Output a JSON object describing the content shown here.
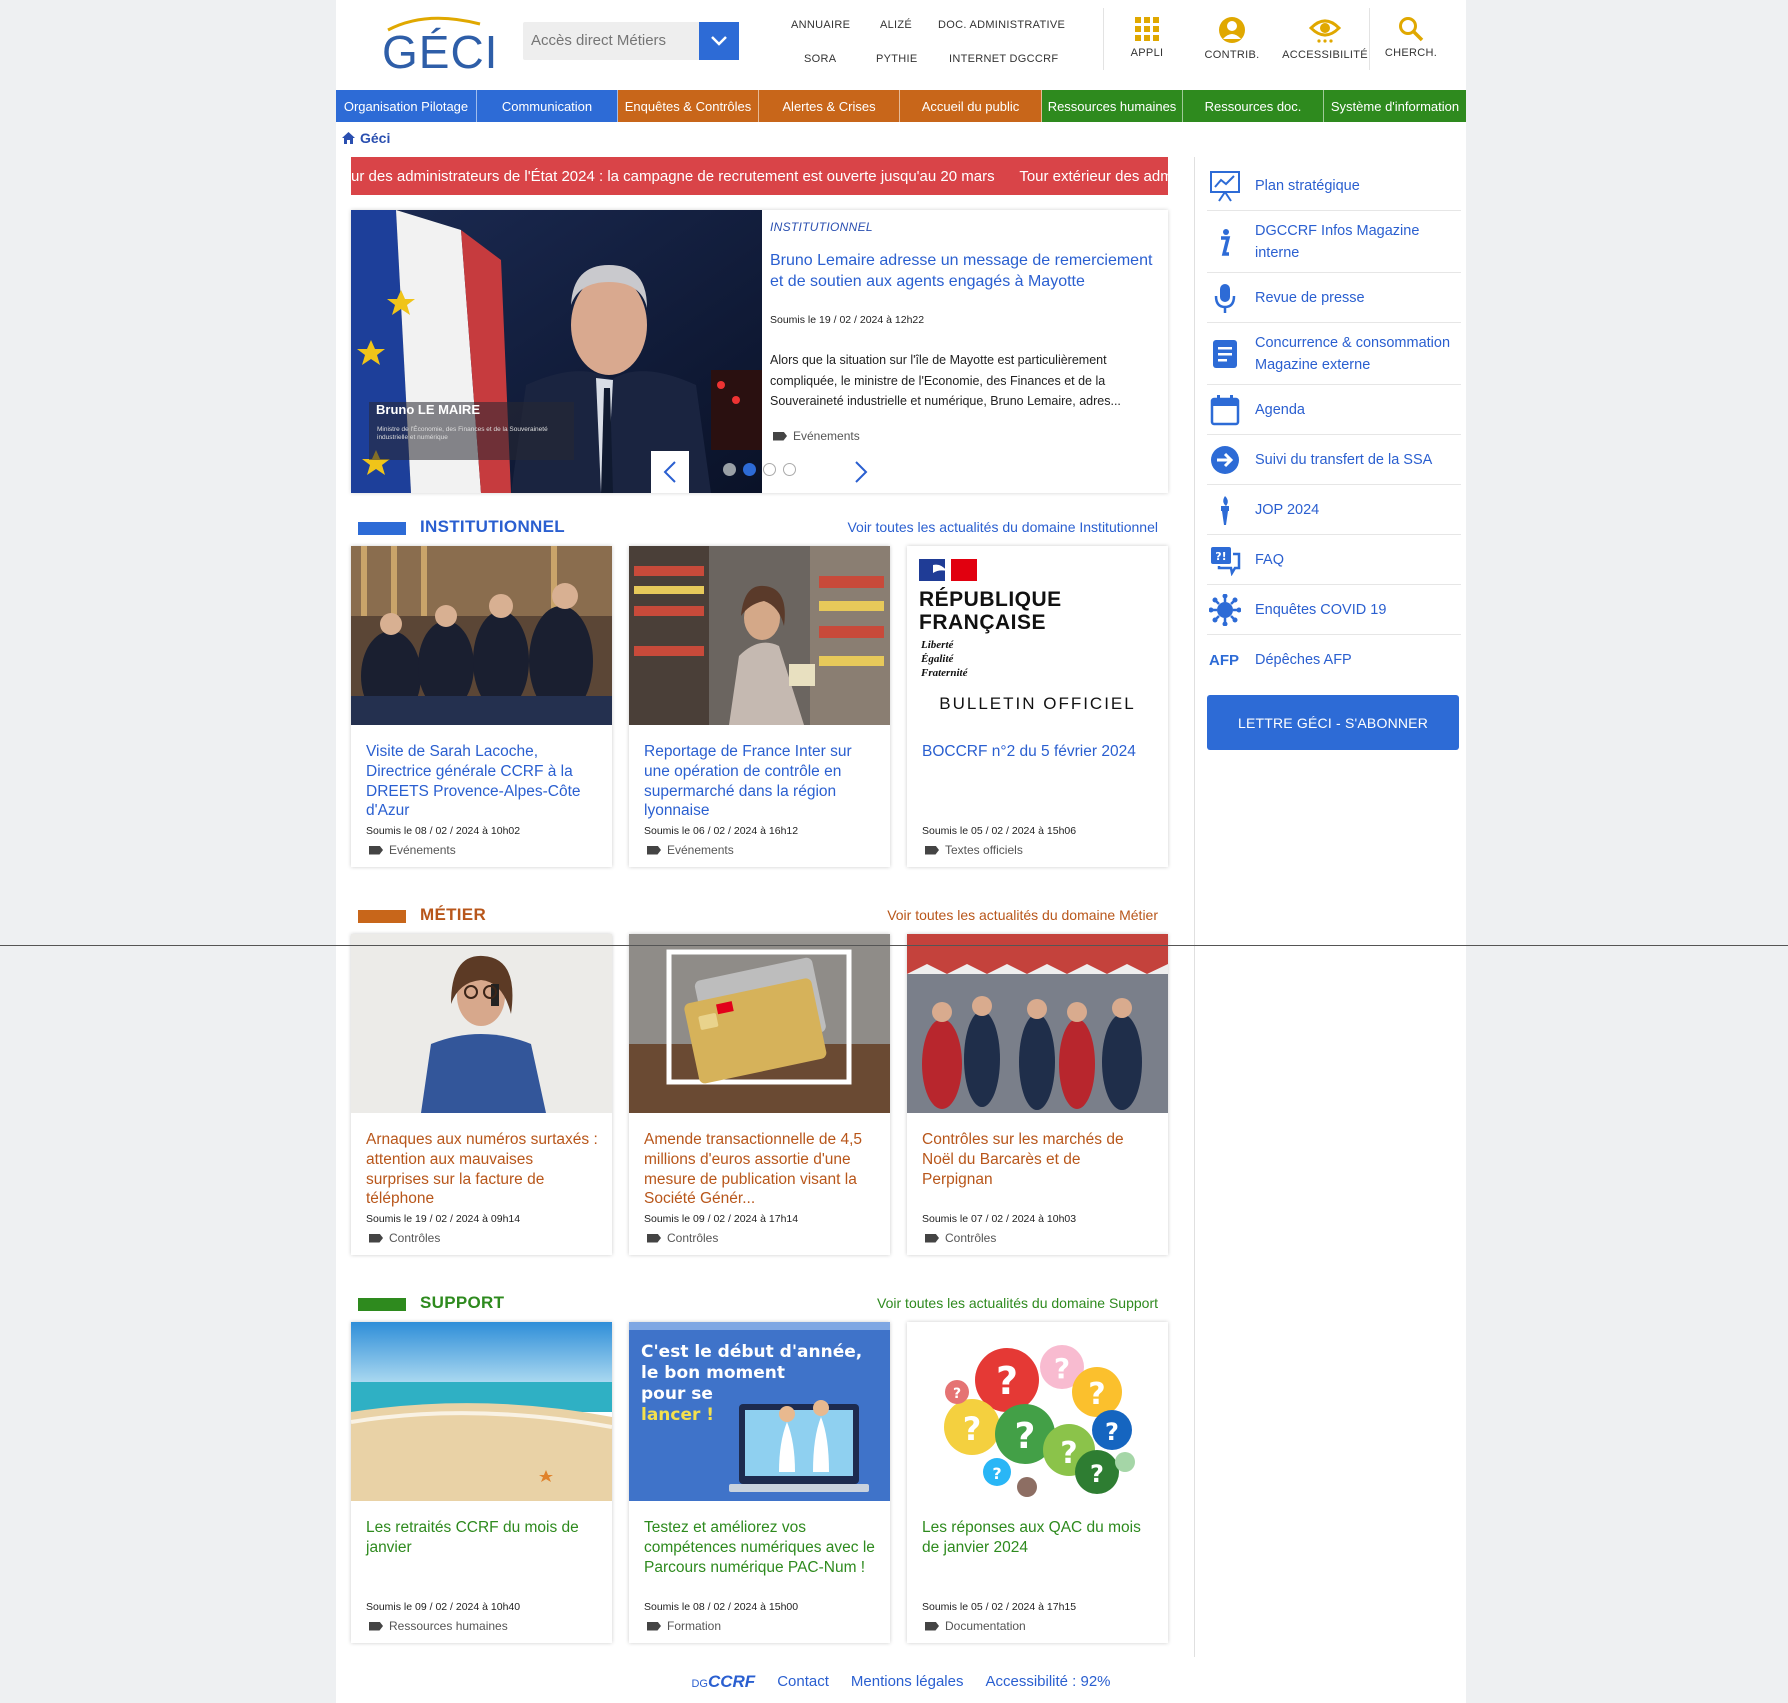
{
  "logo": {
    "text": "GÉCI"
  },
  "search": {
    "placeholder": "Accès direct Métiers"
  },
  "quick_links": [
    "ANNUAIRE",
    "ALIZÉ",
    "DOC. ADMINISTRATIVE",
    "SORA",
    "PYTHIE",
    "INTERNET DGCCRF"
  ],
  "toolbar": {
    "appli": "APPLI",
    "contrib": "CONTRIB.",
    "accessibility": "ACCESSIBILITÉ",
    "search": "CHERCH."
  },
  "nav": [
    {
      "label": "Organisation Pilotage",
      "color": "#2d6bd6"
    },
    {
      "label": "Communication",
      "color": "#2d6bd6"
    },
    {
      "label": "Enquêtes & Contrôles",
      "color": "#c8661a"
    },
    {
      "label": "Alertes & Crises",
      "color": "#c8661a"
    },
    {
      "label": "Accueil du public",
      "color": "#c8661a"
    },
    {
      "label": "Ressources humaines",
      "color": "#2e8a1e"
    },
    {
      "label": "Ressources doc.",
      "color": "#2e8a1e"
    },
    {
      "label": "Système d'information",
      "color": "#2e8a1e"
    }
  ],
  "breadcrumb": "Géci",
  "ticker": "ur des administrateurs de l'État 2024 : la campagne de recrutement est ouverte jusqu'au 20 mars      Tour extérieur des admi",
  "hero": {
    "image_caption_name": "Bruno LE MAIRE",
    "image_caption_role": "Ministre de l'Économie, des Finances et de la Souveraineté industrielle et numérique",
    "category": "INSTITUTIONNEL",
    "title": "Bruno Lemaire adresse un message de remerciement et de soutien aux agents engagés à Mayotte",
    "date": "Soumis le 19 / 02 / 2024 à 12h22",
    "summary": "Alors que la situation sur l'île de Mayotte est particulièrement compliquée, le ministre de l'Economie, des Finances et de la Souveraineté industrielle et numérique, Bruno Lemaire, adres...",
    "tag": "Evénements",
    "slide_index": 2,
    "slide_count": 4
  },
  "sections": [
    {
      "title": "INSTITUTIONNEL",
      "color": "#2d6bd6",
      "link": "Voir toutes les actualités du domaine Institutionnel",
      "cards": [
        {
          "title": "Visite de Sarah Lacoche, Directrice générale CCRF à la DREETS Provence-Alpes-Côte d'Azur",
          "date": "Soumis le 08 / 02 / 2024 à 10h02",
          "tag": "Evénements"
        },
        {
          "title": "Reportage de France Inter sur une opération de contrôle en supermarché dans la région lyonnaise",
          "date": "Soumis le 06 / 02 / 2024 à 16h12",
          "tag": "Evénements"
        },
        {
          "title": "BOCCRF n°2 du 5 février 2024",
          "date": "Soumis le 05 / 02 / 2024 à 15h06",
          "tag": "Textes officiels"
        }
      ]
    },
    {
      "title": "MÉTIER",
      "color": "#c8661a",
      "link": "Voir toutes les actualités du domaine Métier",
      "cards": [
        {
          "title": "Arnaques aux numéros surtaxés : attention aux mauvaises surprises sur la facture de téléphone",
          "date": "Soumis le 19 / 02 / 2024 à 09h14",
          "tag": "Contrôles"
        },
        {
          "title": "Amende transactionnelle de 4,5 millions d'euros assortie d'une mesure de publication visant la Société Génér...",
          "date": "Soumis le 09 / 02 / 2024 à 17h14",
          "tag": "Contrôles"
        },
        {
          "title": "Contrôles sur les marchés de Noël du Barcarès et de Perpignan",
          "date": "Soumis le 07 / 02 / 2024 à 10h03",
          "tag": "Contrôles"
        }
      ]
    },
    {
      "title": "SUPPORT",
      "color": "#2e8a1e",
      "link": "Voir toutes les actualités du domaine Support",
      "cards": [
        {
          "title": "Les retraités CCRF du mois de janvier",
          "date": "Soumis le 09 / 02 / 2024 à 10h40",
          "tag": "Ressources humaines"
        },
        {
          "title": "Testez et améliorez vos compétences numériques avec le Parcours numérique PAC-Num !",
          "date": "Soumis le 08 / 02 / 2024 à 15h00",
          "tag": "Formation"
        },
        {
          "title": "Les réponses aux QAC du mois de janvier 2024",
          "date": "Soumis le 05 / 02 / 2024 à 17h15",
          "tag": "Documentation"
        }
      ]
    }
  ],
  "image_texts": {
    "republique_1": "RÉPUBLIQUE",
    "republique_2": "FRANÇAISE",
    "devise": [
      "Liberté",
      "Égalité",
      "Fraternité"
    ],
    "bulletin": "BULLETIN OFFICIEL",
    "pacnum_1": "C'est le début d'année,",
    "pacnum_2": "le bon moment",
    "pacnum_3": "pour se",
    "pacnum_4": "lancer !"
  },
  "sidebar": [
    {
      "label": "Plan stratégique",
      "icon": "presentation-board-icon"
    },
    {
      "label": "DGCCRF Infos Magazine interne",
      "icon": "info-icon"
    },
    {
      "label": "Revue de presse",
      "icon": "microphone-icon"
    },
    {
      "label": "Concurrence & consommation Magazine externe",
      "icon": "document-icon"
    },
    {
      "label": "Agenda",
      "icon": "calendar-icon"
    },
    {
      "label": "Suivi du transfert de la SSA",
      "icon": "arrow-circle-icon"
    },
    {
      "label": "JOP 2024",
      "icon": "torch-icon"
    },
    {
      "label": "FAQ",
      "icon": "faq-icon"
    },
    {
      "label": "Enquêtes COVID 19",
      "icon": "virus-icon"
    },
    {
      "label": "Dépêches AFP",
      "icon": "afp-icon",
      "icon_text": "AFP"
    }
  ],
  "subscribe": "LETTRE GÉCI - S'ABONNER",
  "footer": {
    "logo_dg": "DG",
    "logo_ccrf": "CCRF",
    "contact": "Contact",
    "legal": "Mentions légales",
    "accessibility": "Accessibilité : 92%"
  }
}
